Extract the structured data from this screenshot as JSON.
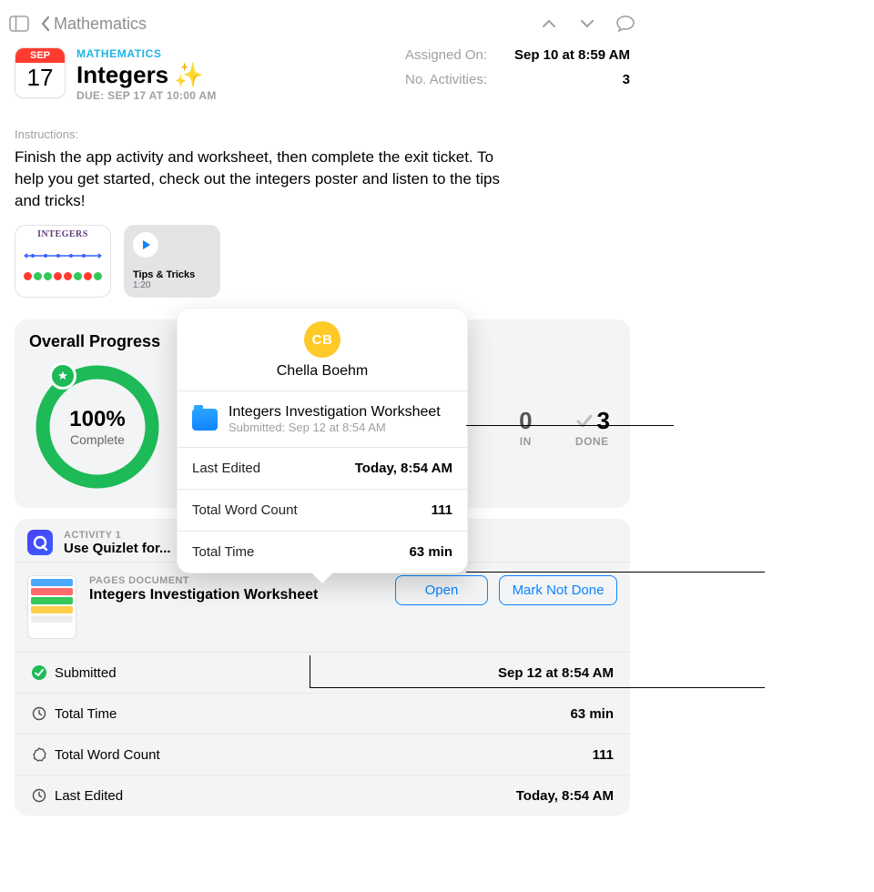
{
  "nav": {
    "back_label": "Mathematics"
  },
  "calendar": {
    "month": "SEP",
    "day": "17"
  },
  "header": {
    "category": "MATHEMATICS",
    "title": "Integers",
    "due": "DUE: SEP 17 AT 10:00 AM",
    "meta": {
      "assigned_label": "Assigned On:",
      "assigned_value": "Sep 10 at 8:59 AM",
      "activities_label": "No. Activities:",
      "activities_value": "3"
    }
  },
  "instructions": {
    "label": "Instructions:",
    "text": "Finish the app activity and worksheet, then complete the exit ticket. To help you get started, check out the integers poster and listen to the tips and tricks!"
  },
  "attachments": {
    "poster_title": "INTEGERS",
    "media_title": "Tips & Tricks",
    "media_duration": "1:20"
  },
  "progress": {
    "heading": "Overall Progress",
    "percent": "100%",
    "complete_label": "Complete",
    "stats": {
      "min": {
        "value": "0",
        "label": "IN"
      },
      "done": {
        "value": "3",
        "label": "DONE"
      }
    }
  },
  "activity": {
    "label": "ACTIVITY 1",
    "title": "Use Quizlet for...",
    "doc_label": "PAGES DOCUMENT",
    "doc_title": "Integers Investigation Worksheet",
    "open": "Open",
    "mark": "Mark Not Done"
  },
  "details": {
    "submitted": {
      "k": "Submitted",
      "v": "Sep 12 at 8:54 AM"
    },
    "time": {
      "k": "Total Time",
      "v": "63 min"
    },
    "words": {
      "k": "Total Word Count",
      "v": "111"
    },
    "edited": {
      "k": "Last Edited",
      "v": "Today, 8:54 AM"
    }
  },
  "popover": {
    "initials": "CB",
    "name": "Chella Boehm",
    "doc_title": "Integers Investigation Worksheet",
    "doc_sub": "Submitted: Sep 12 at 8:54 AM",
    "rows": {
      "edited": {
        "k": "Last Edited",
        "v": "Today, 8:54 AM"
      },
      "words": {
        "k": "Total Word Count",
        "v": "111"
      },
      "time": {
        "k": "Total Time",
        "v": "63 min"
      }
    }
  }
}
